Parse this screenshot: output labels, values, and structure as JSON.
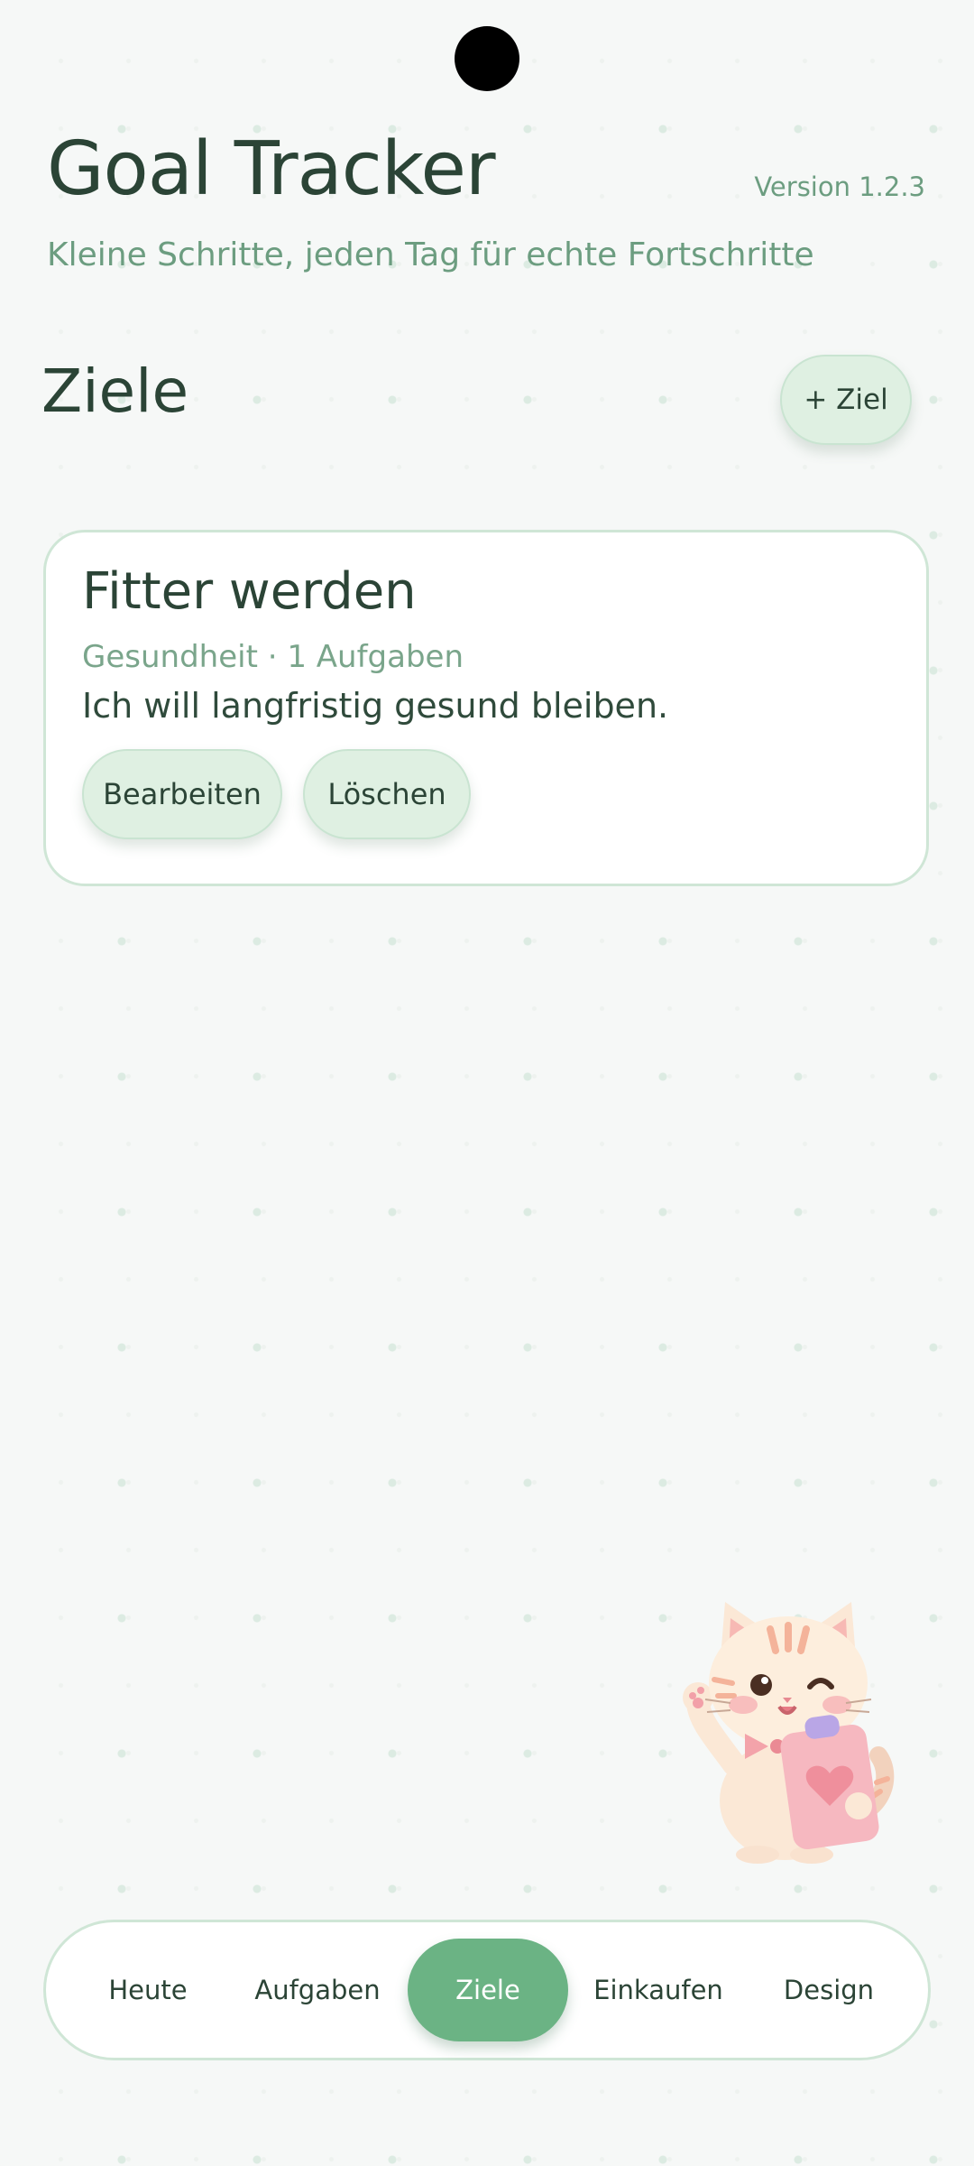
{
  "header": {
    "title": "Goal Tracker",
    "version": "Version 1.2.3",
    "subtitle": "Kleine Schritte, jeden Tag für echte Fortschritte"
  },
  "goals_section": {
    "title": "Ziele",
    "add_button_label": "+ Ziel"
  },
  "goals": [
    {
      "title": "Fitter werden",
      "meta": "Gesundheit · 1 Aufgaben",
      "description": "Ich will langfristig gesund bleiben.",
      "edit_label": "Bearbeiten",
      "delete_label": "Löschen"
    }
  ],
  "nav": {
    "active": "Ziele",
    "items": [
      {
        "label": "Heute"
      },
      {
        "label": "Aufgaben"
      },
      {
        "label": "Ziele"
      },
      {
        "label": "Einkaufen"
      },
      {
        "label": "Design"
      }
    ]
  },
  "mascot": {
    "icon": "cat-mascot-icon"
  },
  "colors": {
    "accent": "#6bb384",
    "pill_bg": "#dff0e2",
    "text_dark": "#2b4436",
    "text_muted": "#6c9d80",
    "background": "#f6f8f7"
  }
}
